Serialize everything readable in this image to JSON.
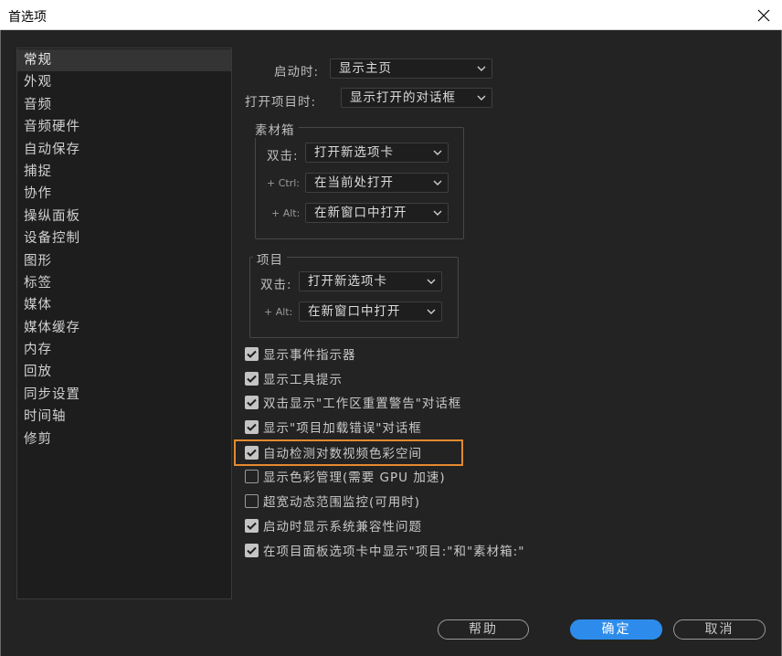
{
  "window": {
    "title": "首选项"
  },
  "sidebar": {
    "items": [
      {
        "label": "常规",
        "selected": true
      },
      {
        "label": "外观"
      },
      {
        "label": "音频"
      },
      {
        "label": "音频硬件"
      },
      {
        "label": "自动保存"
      },
      {
        "label": "捕捉"
      },
      {
        "label": "协作"
      },
      {
        "label": "操纵面板"
      },
      {
        "label": "设备控制"
      },
      {
        "label": "图形"
      },
      {
        "label": "标签"
      },
      {
        "label": "媒体"
      },
      {
        "label": "媒体缓存"
      },
      {
        "label": "内存"
      },
      {
        "label": "回放"
      },
      {
        "label": "同步设置"
      },
      {
        "label": "时间轴"
      },
      {
        "label": "修剪"
      }
    ]
  },
  "general": {
    "startup_label": "启动时:",
    "startup_value": "显示主页",
    "open_project_label": "打开项目时:",
    "open_project_value": "显示打开的对话框"
  },
  "bins": {
    "title": "素材箱",
    "double_click_label": "双击:",
    "double_click_value": "打开新选项卡",
    "ctrl_label": "+ Ctrl:",
    "ctrl_value": "在当前处打开",
    "alt_label": "+ Alt:",
    "alt_value": "在新窗口中打开"
  },
  "projects": {
    "title": "项目",
    "double_click_label": "双击:",
    "double_click_value": "打开新选项卡",
    "alt_label": "+ Alt:",
    "alt_value": "在新窗口中打开"
  },
  "checkboxes": [
    {
      "label": "显示事件指示器",
      "checked": true
    },
    {
      "label": "显示工具提示",
      "checked": true
    },
    {
      "label": "双击显示\"工作区重置警告\"对话框",
      "checked": true
    },
    {
      "label": "显示\"项目加载错误\"对话框",
      "checked": true
    },
    {
      "label": "自动检测对数视频色彩空间",
      "checked": true
    },
    {
      "label": "显示色彩管理(需要 GPU 加速)",
      "checked": false
    },
    {
      "label": "超宽动态范围监控(可用时)",
      "checked": false
    },
    {
      "label": "启动时显示系统兼容性问题",
      "checked": true
    },
    {
      "label": "在项目面板选项卡中显示\"项目:\"和\"素材箱:\"",
      "checked": true
    }
  ],
  "buttons": {
    "help": "帮助",
    "ok": "确定",
    "cancel": "取消"
  },
  "colors": {
    "accent": "#2d8ceb",
    "highlight": "#e38a2e",
    "background": "#232323"
  }
}
